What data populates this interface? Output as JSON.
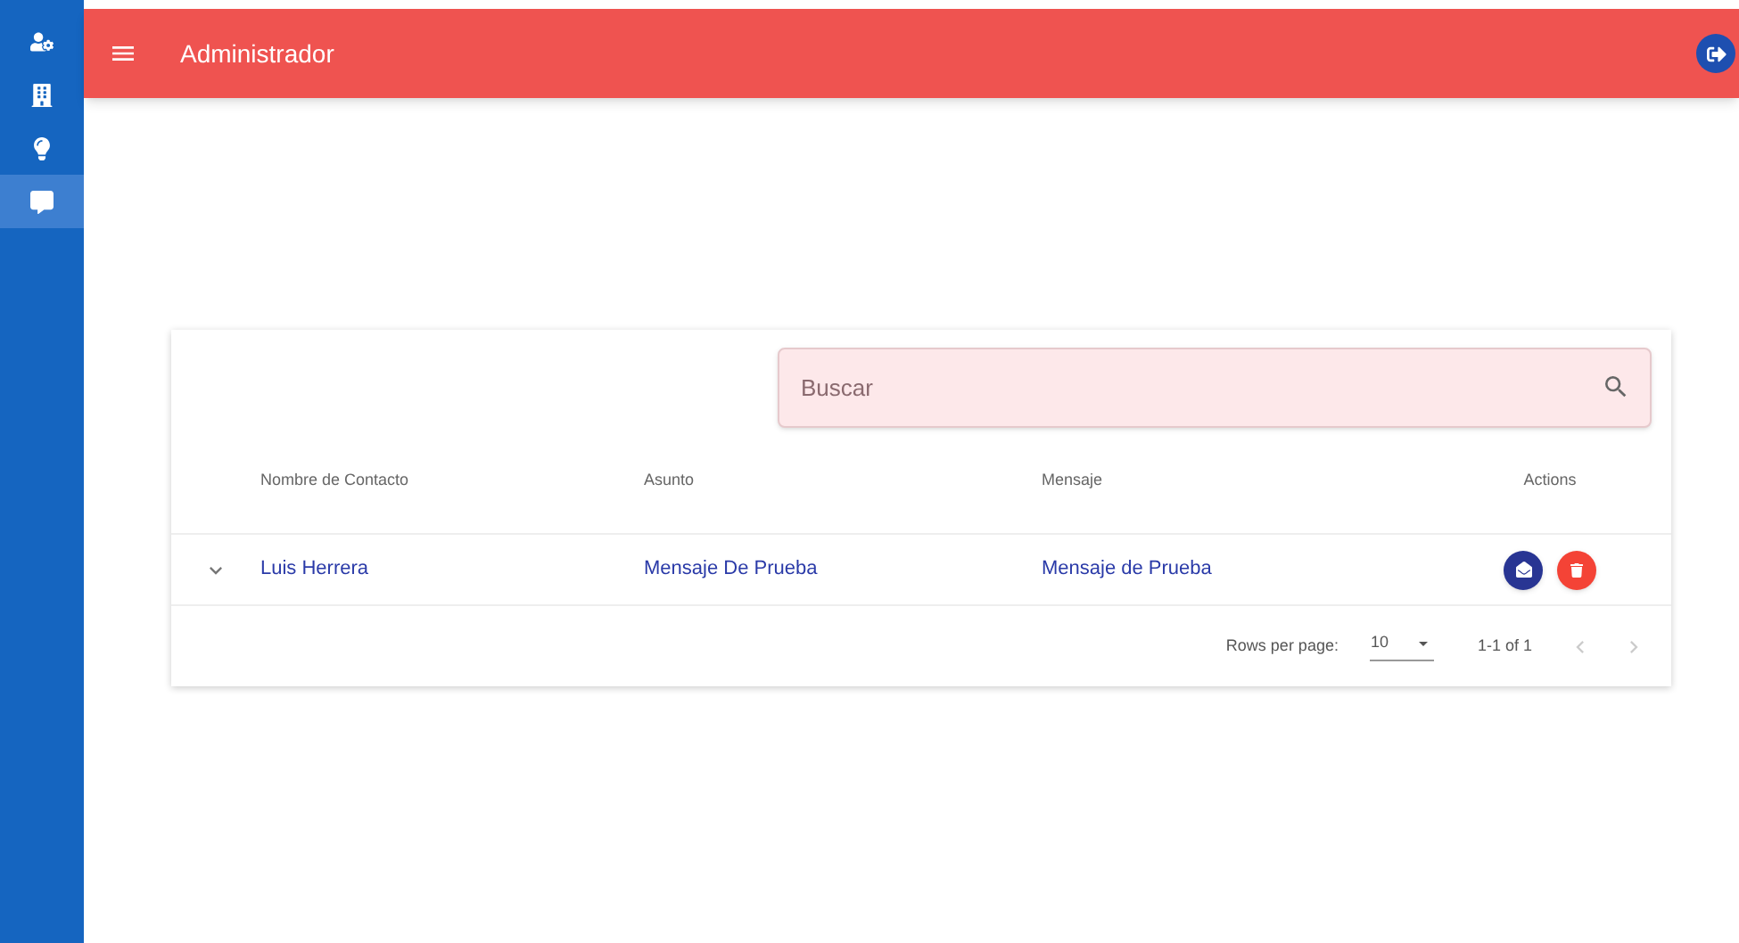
{
  "sidebar": {
    "items": [
      {
        "kind": "users",
        "selected": false
      },
      {
        "kind": "building",
        "selected": false
      },
      {
        "kind": "bulb",
        "selected": false
      },
      {
        "kind": "chat",
        "selected": true
      }
    ]
  },
  "header": {
    "title": "Administrador"
  },
  "search": {
    "placeholder": "Buscar"
  },
  "table": {
    "columns": [
      "Nombre de Contacto",
      "Asunto",
      "Mensaje",
      "Actions"
    ],
    "rows": [
      {
        "expanded": false,
        "cells": [
          "Luis Herrera",
          "Mensaje De Prueba",
          "Mensaje de Prueba"
        ]
      }
    ]
  },
  "pagination": {
    "rows_per_page_label": "Rows per page:",
    "rows_per_page": "10",
    "range": "1-1 of 1"
  }
}
